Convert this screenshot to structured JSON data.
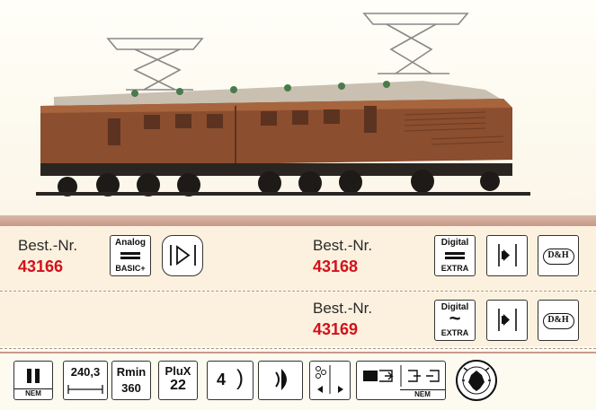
{
  "row1": {
    "left": {
      "label": "Best.-Nr.",
      "number": "43166",
      "icons": [
        {
          "name": "analog-basic-plus-icon",
          "top": "Analog",
          "bottom": "BASIC+"
        },
        {
          "name": "sound-speaker-icon"
        }
      ]
    },
    "right": {
      "label": "Best.-Nr.",
      "number": "43168",
      "icons": [
        {
          "name": "digital-extra-icon",
          "top": "Digital",
          "bottom": "EXTRA"
        },
        {
          "name": "speaker-icon"
        },
        {
          "name": "dh-logo-icon",
          "text": "D&H"
        }
      ]
    }
  },
  "row2": {
    "label": "Best.-Nr.",
    "number": "43169",
    "icons": [
      {
        "name": "digital-ac-extra-icon",
        "top": "Digital",
        "bottom": "EXTRA"
      },
      {
        "name": "speaker-icon"
      },
      {
        "name": "dh-logo-icon",
        "text": "D&H"
      }
    ]
  },
  "specs": {
    "gauge": {
      "name": "gauge-h0-nem-icon",
      "text": "NEM"
    },
    "length": {
      "name": "length-icon",
      "value": "240,3"
    },
    "rmin": {
      "name": "min-radius-icon",
      "label": "Rmin",
      "value": "360"
    },
    "plux": {
      "name": "plux22-icon",
      "label": "PluX",
      "value": "22"
    },
    "lights": {
      "name": "headlight-icon",
      "value": "4"
    },
    "taillight": {
      "name": "taillight-icon"
    },
    "direction": {
      "name": "direction-lights-icon"
    },
    "coupling": {
      "name": "coupling-nem-icon",
      "text": "NEM"
    },
    "railway": {
      "name": "deutsche-reichsbahn-emblem-icon"
    }
  },
  "colors": {
    "accent": "#d3101a",
    "band": "#c7988a",
    "row": "#fbf1de"
  }
}
